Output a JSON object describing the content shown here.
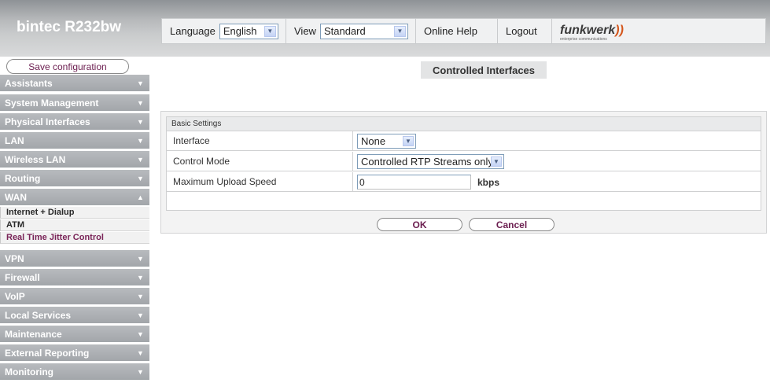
{
  "app": {
    "title": "bintec R232bw"
  },
  "topbar": {
    "language_label": "Language",
    "language_value": "English",
    "view_label": "View",
    "view_value": "Standard",
    "online_help": "Online Help",
    "logout": "Logout",
    "vendor_logo": "funkwerk",
    "vendor_tagline": "enterprise communications"
  },
  "sidebar": {
    "save_label": "Save configuration",
    "items": [
      {
        "label": "Assistants",
        "arrow": "▼"
      },
      {
        "label": "System Management",
        "arrow": "▼"
      },
      {
        "label": "Physical Interfaces",
        "arrow": "▼"
      },
      {
        "label": "LAN",
        "arrow": "▼"
      },
      {
        "label": "Wireless LAN",
        "arrow": "▼"
      },
      {
        "label": "Routing",
        "arrow": "▼"
      },
      {
        "label": "WAN",
        "arrow": "▲"
      },
      {
        "label": "VPN",
        "arrow": "▼"
      },
      {
        "label": "Firewall",
        "arrow": "▼"
      },
      {
        "label": "VoIP",
        "arrow": "▼"
      },
      {
        "label": "Local Services",
        "arrow": "▼"
      },
      {
        "label": "Maintenance",
        "arrow": "▼"
      },
      {
        "label": "External Reporting",
        "arrow": "▼"
      },
      {
        "label": "Monitoring",
        "arrow": "▼"
      }
    ],
    "wan_sub": [
      {
        "label": "Internet + Dialup"
      },
      {
        "label": "ATM"
      },
      {
        "label": "Real Time Jitter Control"
      }
    ]
  },
  "main": {
    "page_title": "Controlled Interfaces",
    "section_title": "Basic Settings",
    "fields": {
      "interface_label": "Interface",
      "interface_value": "None",
      "control_mode_label": "Control Mode",
      "control_mode_value": "Controlled RTP Streams only",
      "max_upload_label": "Maximum Upload Speed",
      "max_upload_value": "0",
      "max_upload_unit": "kbps"
    },
    "ok_label": "OK",
    "cancel_label": "Cancel"
  },
  "colors": {
    "accent": "#7a2458",
    "menu_bg": "#a9adb1",
    "header_bg": "#b7b9bb"
  }
}
